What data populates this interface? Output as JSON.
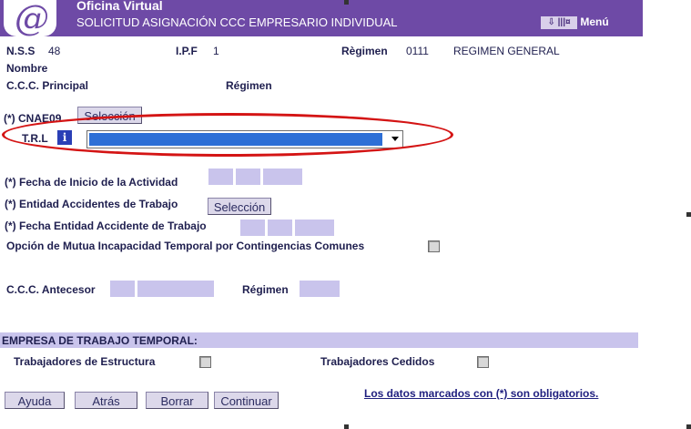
{
  "header": {
    "logo": "@",
    "title": "Oficina Virtual",
    "subtitle": "SOLICITUD ASIGNACIÓN CCC EMPRESARIO INDIVIDUAL",
    "menu_icon_text": "⇩ |||¤",
    "menu_label": "Menú"
  },
  "ident": {
    "nss_label": "N.S.S",
    "nss_value": "48",
    "ipf_label": "I.P.F",
    "ipf_value": "1",
    "regimen_label": "Règimen",
    "regimen_code": "0111",
    "regimen_name": "REGIMEN GENERAL",
    "nombre_label": "Nombre",
    "ccc_label": "C.C.C. Principal",
    "regimen2_label": "Régimen"
  },
  "form": {
    "asterisk": "(*)",
    "cnae_label": "CNAE09",
    "cnae_button": "Selección",
    "trl_label": "T.R.L",
    "trl_info": "i",
    "fecha_inicio_label": "Fecha de Inicio de la Actividad",
    "entidad_label": "Entidad Accidentes de Trabajo",
    "entidad_button": "Selección",
    "fecha_entidad_label": "Fecha Entidad Accidente de Trabajo",
    "mutua_label": "Opción de Mutua Incapacidad Temporal por Contingencias Comunes",
    "antecesor_label": "C.C.C. Antecesor",
    "antecesor_regimen_label": "Régimen"
  },
  "ett": {
    "section_title": "EMPRESA DE TRABAJO TEMPORAL:",
    "estructura_label": "Trabajadores de Estructura",
    "cedidos_label": "Trabajadores Cedidos"
  },
  "actions": {
    "ayuda": "Ayuda",
    "atras": "Atrás",
    "borrar": "Borrar",
    "continuar": "Continuar",
    "note": "Los datos marcados con (*) son obligatorios."
  },
  "colors": {
    "header": "#6e4aa6",
    "field": "#c9c4ec",
    "highlight_ring": "#d41414",
    "select_fill": "#2d6fd6"
  }
}
